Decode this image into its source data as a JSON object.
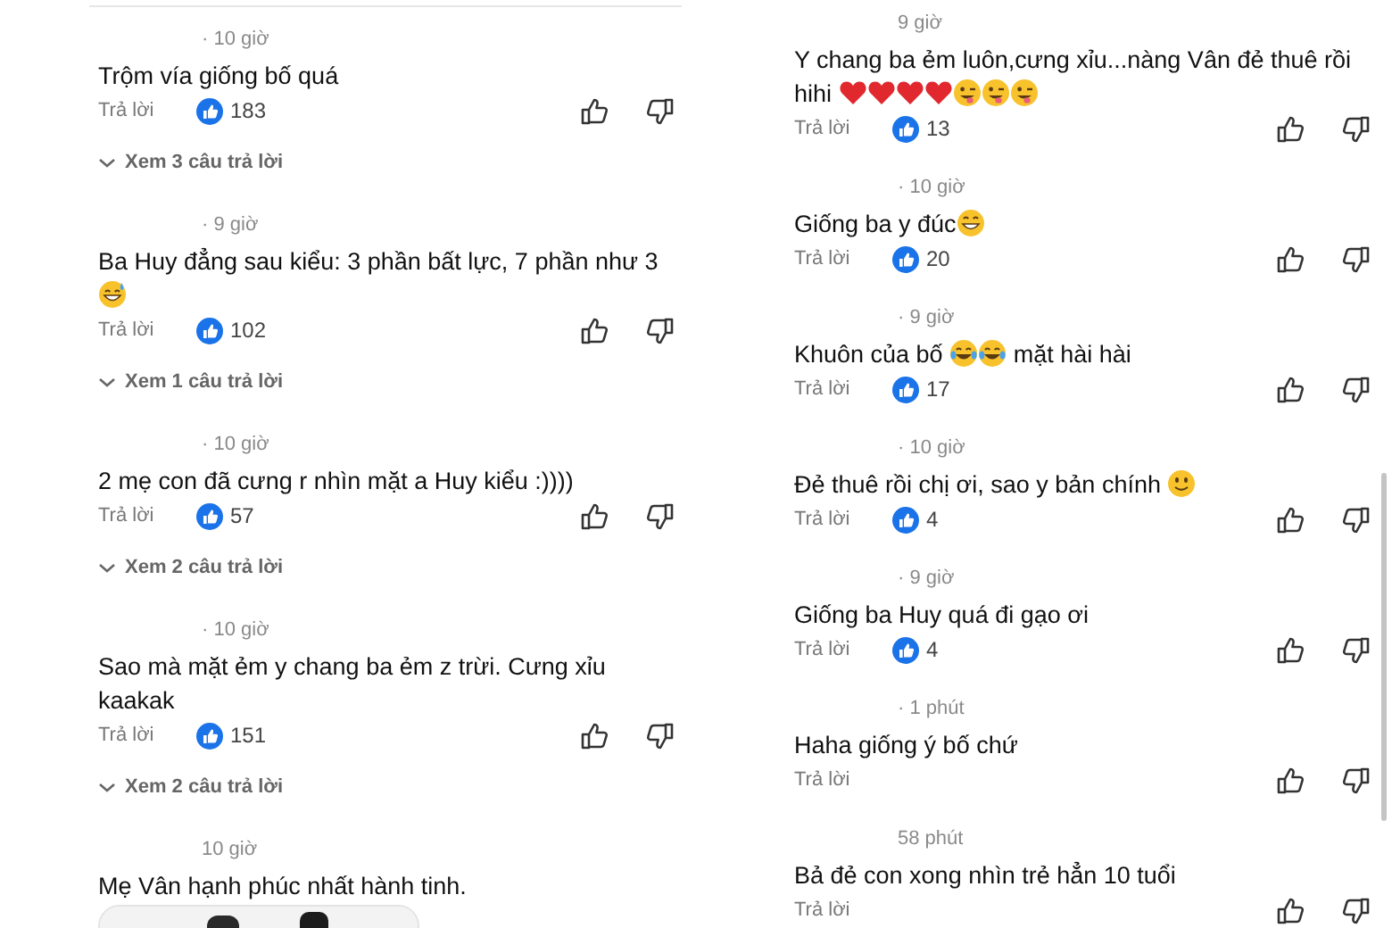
{
  "columns": [
    {
      "comments": [
        {
          "time": "· 10 giờ",
          "body": [
            {
              "kind": "text",
              "text": "Trộm vía giống bố quá"
            }
          ],
          "reply": "Trả lời",
          "likes": "183",
          "replies_link": "Xem 3 câu trả lời"
        },
        {
          "time": "· 9 giờ",
          "body": [
            {
              "kind": "text",
              "text": "Ba Huy đẳng sau kiểu: 3 phần bất lực, 7 phần như 3 "
            },
            {
              "kind": "sweat"
            }
          ],
          "reply": "Trả lời",
          "likes": "102",
          "replies_link": "Xem 1 câu trả lời"
        },
        {
          "time": "· 10 giờ",
          "body": [
            {
              "kind": "text",
              "text": "2 mẹ con đã cưng r nhìn mặt a Huy kiểu :))))"
            }
          ],
          "reply": "Trả lời",
          "likes": "57",
          "replies_link": "Xem 2 câu trả lời"
        },
        {
          "time": "· 10 giờ",
          "body": [
            {
              "kind": "text",
              "text": "Sao mà mặt ẻm y chang ba ẻm z trừi. Cưng xỉu kaakak"
            }
          ],
          "reply": "Trả lời",
          "likes": "151",
          "replies_link": "Xem 2 câu trả lời"
        },
        {
          "time": "10 giờ",
          "body": [
            {
              "kind": "text",
              "text": "Mẹ Vân hạnh phúc nhất hành tinh."
            }
          ],
          "attachment": {
            "kind": "picture"
          }
        }
      ]
    },
    {
      "comments": [
        {
          "time": "9 giờ",
          "body": [
            {
              "kind": "text",
              "text": "Y chang ba ẻm luôn,cưng xỉu...nàng Vân đẻ thuê rồi hihi "
            },
            {
              "kind": "heart"
            },
            {
              "kind": "heart"
            },
            {
              "kind": "heart"
            },
            {
              "kind": "heart"
            },
            {
              "kind": "wink"
            },
            {
              "kind": "wink"
            },
            {
              "kind": "wink"
            }
          ],
          "reply": "Trả lời",
          "likes": "13"
        },
        {
          "time": "· 10 giờ",
          "body": [
            {
              "kind": "text",
              "text": "Giống ba y đúc"
            },
            {
              "kind": "grin"
            }
          ],
          "reply": "Trả lời",
          "likes": "20"
        },
        {
          "time": "· 9 giờ",
          "body": [
            {
              "kind": "text",
              "text": "Khuôn của bố "
            },
            {
              "kind": "laugh"
            },
            {
              "kind": "laugh"
            },
            {
              "kind": "text",
              "text": " mặt hài hài"
            }
          ],
          "reply": "Trả lời",
          "likes": "17"
        },
        {
          "time": "· 10 giờ",
          "body": [
            {
              "kind": "text",
              "text": "Đẻ thuê rồi chị ơi, sao y bản chính "
            },
            {
              "kind": "smile"
            }
          ],
          "reply": "Trả lời",
          "likes": "4"
        },
        {
          "time": "· 9 giờ",
          "body": [
            {
              "kind": "text",
              "text": "Giống ba Huy quá đi gạo ơi"
            }
          ],
          "reply": "Trả lời",
          "likes": "4"
        },
        {
          "time": "· 1 phút",
          "body": [
            {
              "kind": "text",
              "text": "Haha giống ý bố chứ"
            }
          ],
          "reply": "Trả lời"
        },
        {
          "time": "58 phút",
          "body": [
            {
              "kind": "text",
              "text": "Bả đẻ con xong nhìn trẻ hẳn 10 tuổi"
            }
          ],
          "reply": "Trả lời"
        }
      ]
    }
  ]
}
